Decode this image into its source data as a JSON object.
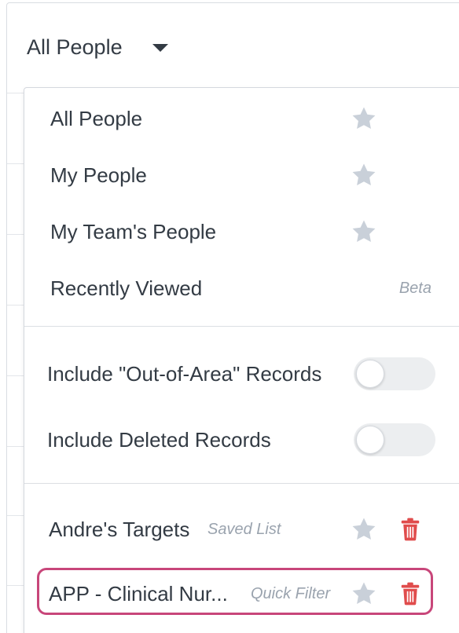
{
  "selector": {
    "label": "All People",
    "icon": "caret-down-icon"
  },
  "views": [
    {
      "label": "All People",
      "icon": "star-icon"
    },
    {
      "label": "My People",
      "icon": "star-icon"
    },
    {
      "label": "My Team's People",
      "icon": "star-icon"
    },
    {
      "label": "Recently Viewed",
      "badge": "Beta"
    }
  ],
  "toggles": [
    {
      "label": "Include \"Out-of-Area\" Records",
      "on": false
    },
    {
      "label": "Include Deleted Records",
      "on": false
    }
  ],
  "lists": [
    {
      "label": "Andre's Targets",
      "tag": "Saved List",
      "star_icon": "star-icon",
      "delete_icon": "trash-icon"
    },
    {
      "label": "APP - Clinical Nur...",
      "tag": "Quick Filter",
      "star_icon": "star-icon",
      "delete_icon": "trash-icon"
    }
  ],
  "colors": {
    "star": "#c9d0d9",
    "trash": "#e04c4c",
    "highlight": "#c8467a",
    "text": "#333b44",
    "muted": "#9aa3ae"
  }
}
